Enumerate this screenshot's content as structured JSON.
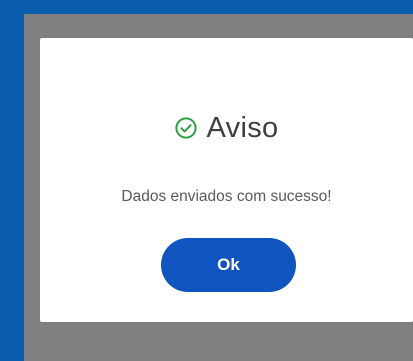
{
  "dialog": {
    "title": "Aviso",
    "title_icon": "check-circle-icon",
    "message": "Dados enviados com sucesso!",
    "ok_label": "Ok"
  },
  "colors": {
    "accent_blue": "#0b5eae",
    "button_blue": "#1055bf",
    "success_green": "#2f9e44",
    "overlay_gray": "#808080"
  }
}
